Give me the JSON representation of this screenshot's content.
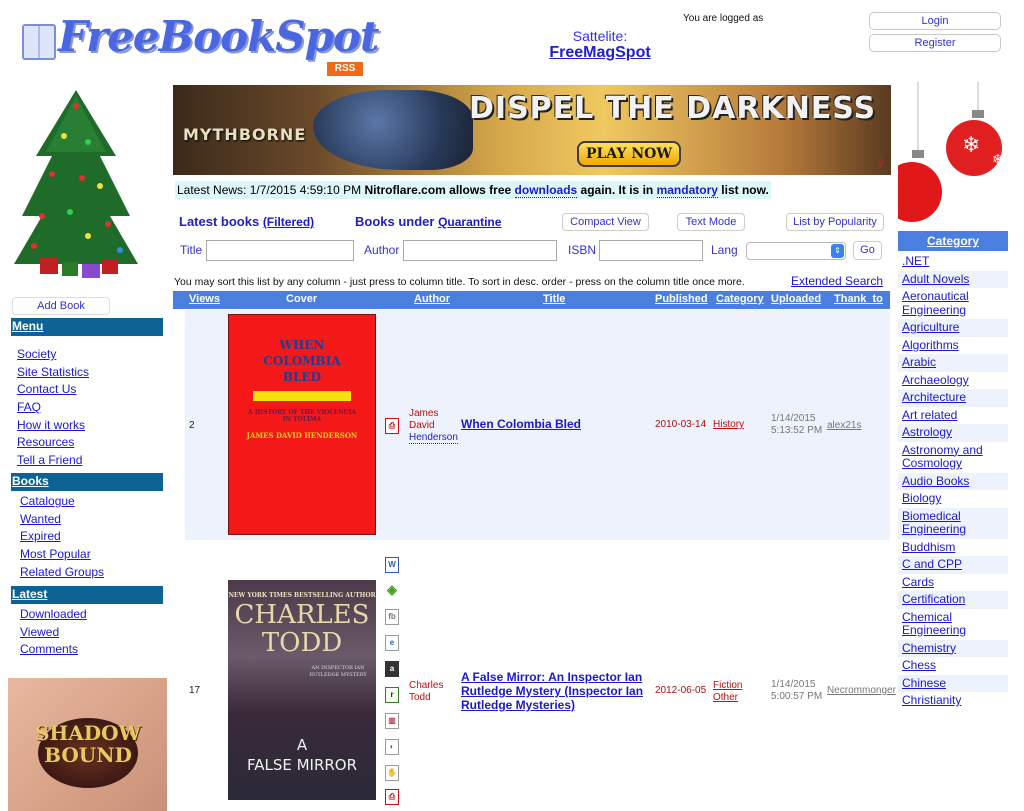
{
  "header": {
    "logo_text": "FreeBookSpot",
    "rss_label": "RSS",
    "satellite_label": "Sattelite:",
    "satellite_link": "FreeMagSpot",
    "logged_as": "You are logged as",
    "login_label": "Login",
    "register_label": "Register"
  },
  "banner": {
    "brand": "MYTHBORNE",
    "headline": "DISPEL THE DARKNESS",
    "cta": "PLAY NOW"
  },
  "news": {
    "prefix": "Latest News: 1/7/2015 4:59:10 PM",
    "text_before": "Nitroflare.com allows free",
    "link1": "downloads",
    "text_middle": "again. It is in",
    "link2": "mandatory",
    "text_after": "list now."
  },
  "toolbar": {
    "latest_books": "Latest books",
    "filtered": "(Filtered)",
    "books_under": "Books under",
    "quarantine": "Quarantine",
    "compact_view": "Compact View",
    "text_mode": "Text Mode",
    "list_by_popularity": "List by Popularity"
  },
  "filters": {
    "title_label": "Title",
    "title_value": "",
    "author_label": "Author",
    "author_value": "",
    "isbn_label": "ISBN",
    "isbn_value": "",
    "lang_label": "Lang",
    "lang_value": "",
    "go_label": "Go"
  },
  "sort_note": "You may sort this list by any column - just press to column title. To sort in desc. order - press on the column title once more.",
  "extended_search": "Extended Search",
  "table": {
    "columns": [
      "Views",
      "Cover",
      "Author",
      "Title",
      "Published",
      "Category",
      "Uploaded",
      "Thank_to"
    ],
    "rows": [
      {
        "views": "2",
        "cover": {
          "title_lines": [
            "WHEN",
            "COLOMBIA",
            "BLED"
          ],
          "subtitle": "A HISTORY OF THE VIOLENCIA IN TOLIMA",
          "author": "JAMES DAVID HENDERSON"
        },
        "formats": [
          "pdf"
        ],
        "author_first": [
          "James",
          "David"
        ],
        "author_last": "Henderson",
        "title": "When Colombia Bled",
        "published": "2010-03-14",
        "categories": [
          "History"
        ],
        "uploaded_date": "1/14/2015",
        "uploaded_time": "5:13:52 PM",
        "thank_to": "alex21s"
      },
      {
        "views": "17",
        "cover": {
          "tagline": "NEW YORK TIMES BESTSELLING AUTHOR",
          "author_lines": [
            "CHARLES",
            "TODD"
          ],
          "series": "AN INSPECTOR IAN RUTLEDGE MYSTERY",
          "title_lines": [
            "A",
            "FALSE MIRROR"
          ]
        },
        "formats": [
          "doc",
          "epub",
          "fb2",
          "lit",
          "azw",
          "mobi",
          "djvu",
          "lrf",
          "rtf",
          "pdf"
        ],
        "author_first": [
          "Charles",
          "Todd"
        ],
        "author_last": "",
        "title": "A False Mirror: An Inspector Ian Rutledge Mystery (Inspector Ian Rutledge Mysteries)",
        "published": "2012-06-05",
        "categories": [
          "Fiction",
          "Other"
        ],
        "uploaded_date": "1/14/2015",
        "uploaded_time": "5:00:57 PM",
        "thank_to": "Necrommonger"
      }
    ]
  },
  "sidebar": {
    "add_book": "Add Book",
    "menu_header": "Menu",
    "menu_items": [
      "Society",
      "Site Statistics",
      "Contact Us",
      "FAQ",
      "How it works",
      "Resources",
      "Tell a Friend"
    ],
    "books_header": "Books",
    "books_items": [
      "Catalogue",
      "Wanted",
      "Expired",
      "Most Popular",
      "Related Groups"
    ],
    "latest_header": "Latest",
    "latest_items": [
      "Downloaded",
      "Viewed",
      "Comments"
    ],
    "ad_text_lines": [
      "SHADOW",
      "BOUND"
    ]
  },
  "categories": {
    "header": "Category",
    "items": [
      ".NET",
      "Adult Novels",
      "Aeronautical Engineering",
      "Agriculture",
      "Algorithms",
      "Arabic",
      "Archaeology",
      "Architecture",
      "Art related",
      "Astrology",
      "Astronomy and Cosmology",
      "Audio Books",
      "Biology",
      "Biomedical Engineering",
      "Buddhism",
      "C and CPP",
      "Cards",
      "Certification",
      "Chemical Engineering",
      "Chemistry",
      "Chess",
      "Chinese",
      "Christianity"
    ]
  },
  "colors": {
    "link": "#1a1acc",
    "sidebar_header": "#0c6394",
    "table_header": "#4a7fe0",
    "row_alt": "#eef2fc",
    "news_bg": "#dcf6fa",
    "author_red": "#bb1111",
    "rss_orange": "#f06a1b"
  }
}
